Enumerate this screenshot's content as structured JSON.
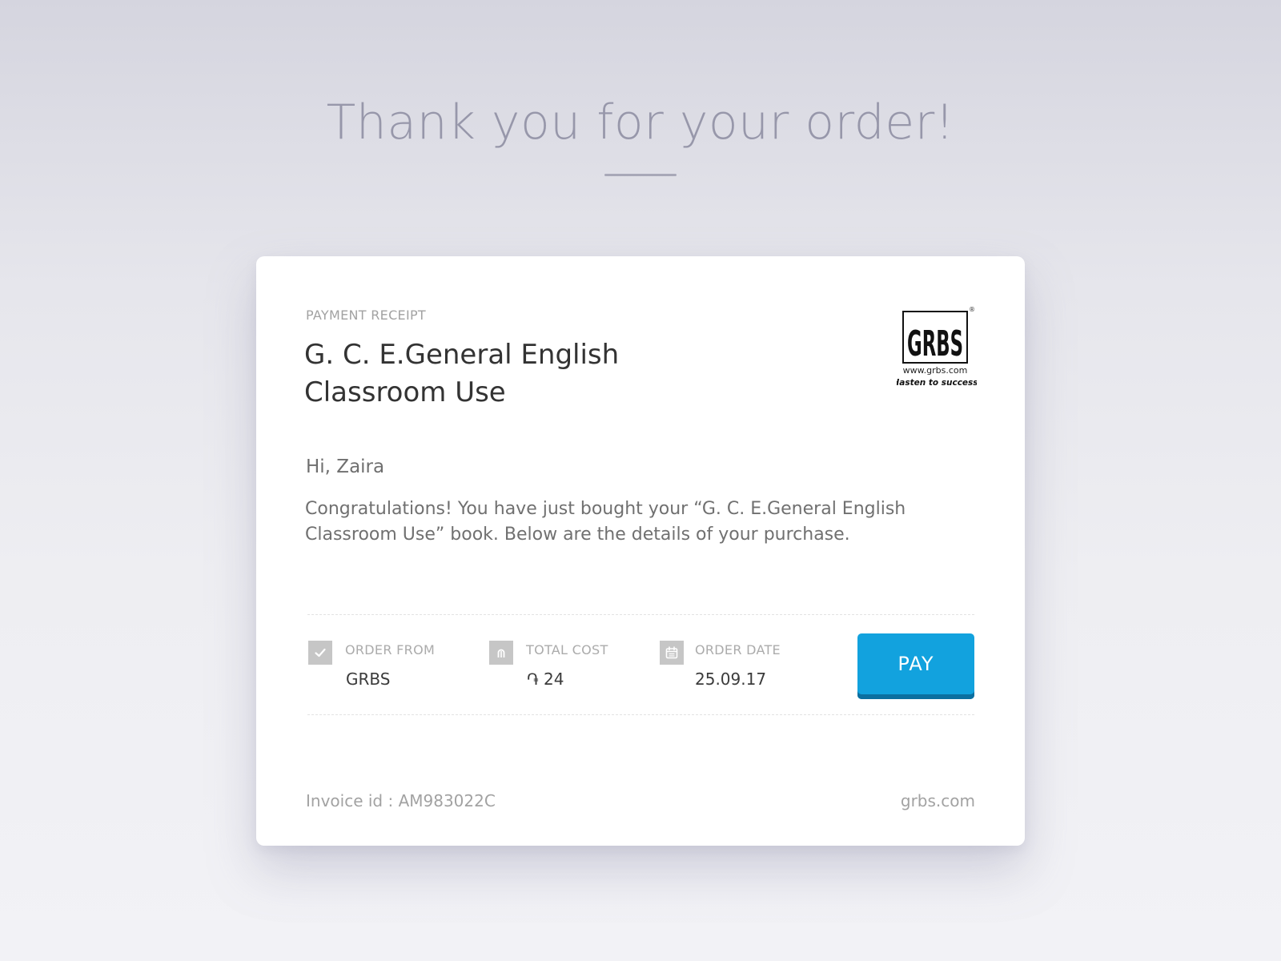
{
  "page": {
    "headline": "Thank you for your order!"
  },
  "receipt": {
    "eyebrow": "PAYMENT RECEIPT",
    "product_title": "G. C. E.General English Classroom Use",
    "logo": {
      "wordmark": "GRBS",
      "url_text": "www.grbs.com",
      "tagline": "Hasten to success",
      "registered_mark": "®"
    },
    "greeting": "Hi, Zaira",
    "message": "Congratulations! You have just bought your “G. C. E.General English Classroom Use” book. Below are the details of your purchase."
  },
  "details": {
    "order_from": {
      "label": "ORDER FROM",
      "value": "GRBS",
      "icon": "checkmark-icon"
    },
    "total_cost": {
      "label": "TOTAL COST",
      "value": "֏ 24",
      "icon": "dram-currency-icon"
    },
    "order_date": {
      "label": "ORDER DATE",
      "value": "25.09.17",
      "icon": "calendar-icon"
    },
    "pay_label": "PAY"
  },
  "footer": {
    "invoice": "Invoice id : AM983022C",
    "site": "grbs.com"
  },
  "colors": {
    "accent": "#12a2de",
    "accent_dark": "#0b6fa0",
    "headline": "#9797aa",
    "card": "#ffffff"
  }
}
